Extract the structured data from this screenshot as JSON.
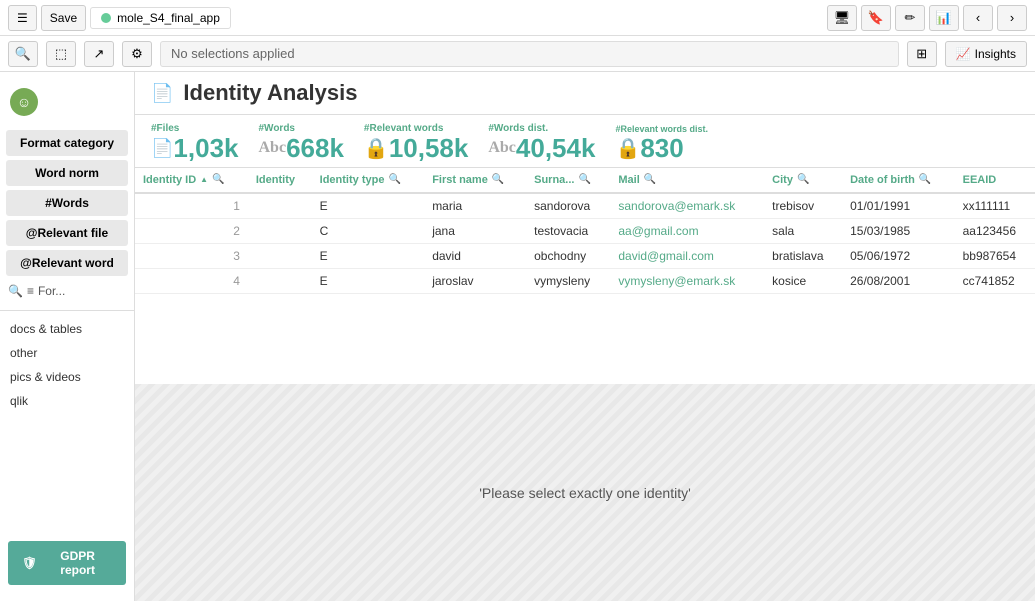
{
  "toolbar": {
    "save_label": "Save",
    "app_name": "mole_S4_final_app",
    "insights_label": "Insights"
  },
  "selection_bar": {
    "text": "No selections applied"
  },
  "sidebar": {
    "logo_char": "☺",
    "buttons": [
      {
        "id": "format-category",
        "label": "Format category"
      },
      {
        "id": "word-norm",
        "label": "Word norm"
      },
      {
        "id": "words",
        "label": "#Words"
      },
      {
        "id": "relevant-file",
        "label": "@Relevant file"
      },
      {
        "id": "relevant-word",
        "label": "@Relevant word"
      }
    ],
    "search_label": "For...",
    "items": [
      {
        "id": "docs-tables",
        "label": "docs & tables"
      },
      {
        "id": "other",
        "label": "other"
      },
      {
        "id": "pics-videos",
        "label": "pics & videos"
      },
      {
        "id": "qlik",
        "label": "qlik"
      }
    ],
    "gdpr_label": "GDPR report"
  },
  "content": {
    "title": "Identity Analysis",
    "stats": [
      {
        "id": "files",
        "label": "#Files",
        "value": "1,03k",
        "icon": "file"
      },
      {
        "id": "words",
        "label": "#Words",
        "value": "668k",
        "icon": "abc"
      },
      {
        "id": "relevant-words",
        "label": "#Relevant words",
        "value": "10,58k",
        "icon": "lock"
      },
      {
        "id": "words-dist",
        "label": "#Words dist.",
        "value": "40,54k",
        "icon": "abc"
      },
      {
        "id": "relevant-words-dist",
        "label": "#Relevant words dist.",
        "value": "830",
        "icon": "lock"
      }
    ],
    "table": {
      "columns": [
        {
          "id": "identity-id",
          "label": "Identity ID",
          "searchable": true,
          "sortable": true
        },
        {
          "id": "identity",
          "label": "Identity",
          "searchable": false
        },
        {
          "id": "identity-type",
          "label": "Identity type",
          "searchable": true
        },
        {
          "id": "first-name",
          "label": "First name",
          "searchable": true
        },
        {
          "id": "surname",
          "label": "Surna...",
          "searchable": true
        },
        {
          "id": "mail",
          "label": "Mail",
          "searchable": true
        },
        {
          "id": "city",
          "label": "City",
          "searchable": true
        },
        {
          "id": "date-of-birth",
          "label": "Date of birth",
          "searchable": true
        },
        {
          "id": "eeaid",
          "label": "EEAID",
          "searchable": false
        }
      ],
      "rows": [
        {
          "id": 1,
          "identity": "",
          "type": "E",
          "first_name": "maria",
          "surname": "sandorova",
          "mail": "sandorova@emark.sk",
          "city": "trebisov",
          "dob": "01/01/1991",
          "eeaid": "xx111111"
        },
        {
          "id": 2,
          "identity": "",
          "type": "C",
          "first_name": "jana",
          "surname": "testovacia",
          "mail": "aa@gmail.com",
          "city": "sala",
          "dob": "15/03/1985",
          "eeaid": "aa123456"
        },
        {
          "id": 3,
          "identity": "",
          "type": "E",
          "first_name": "david",
          "surname": "obchodny",
          "mail": "david@gmail.com",
          "city": "bratislava",
          "dob": "05/06/1972",
          "eeaid": "bb987654"
        },
        {
          "id": 4,
          "identity": "",
          "type": "E",
          "first_name": "jaroslav",
          "surname": "vymysleny",
          "mail": "vymysleny@emark.sk",
          "city": "kosice",
          "dob": "26/08/2001",
          "eeaid": "cc741852"
        }
      ]
    },
    "bottom_message": "'Please select exactly one identity'"
  }
}
